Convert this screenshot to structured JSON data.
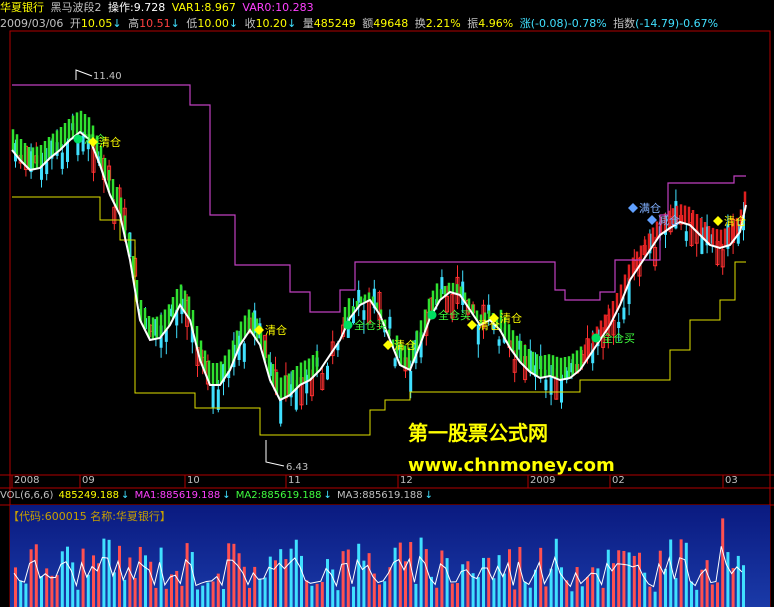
{
  "header": {
    "stock_name": "华夏银行",
    "indicator_name": "黑马波段2",
    "op_label": "操作:9.728",
    "var1": "VAR1:8.967",
    "var0": "VAR0:10.283"
  },
  "quote": {
    "date": "2009/03/06",
    "open_label": "开",
    "open": "10.05",
    "high_label": "高",
    "high": "10.51",
    "low_label": "低",
    "low": "10.00",
    "close_label": "收",
    "close": "10.20",
    "volume_label": "量",
    "volume": "485249",
    "amount_label": "额",
    "amount": "49648",
    "turnover_label": "换",
    "turnover": "2.21%",
    "amplitude_label": "振",
    "amplitude": "4.96%",
    "change_label": "涨",
    "change": "(-0.08)-0.78%",
    "index_label": "指数",
    "index_change": "(-14.79)-0.67%"
  },
  "price_labels": {
    "high_mark": "11.40",
    "low_mark": "6.43"
  },
  "signals": {
    "clear": "清仓",
    "full_buy": "全仓买",
    "add": "满仓",
    "reduce": "减仓"
  },
  "date_axis": [
    "2008",
    "09",
    "10",
    "11",
    "12",
    "2009",
    "02",
    "03"
  ],
  "volume_header": {
    "title": "VOL(6,6,6)",
    "vol": "485249.188",
    "ma1": "MA1:885619.188",
    "ma2": "MA2:885619.188",
    "ma3": "MA3:885619.188"
  },
  "info_bar": "【代码:600015 名称:华夏银行】",
  "watermark": {
    "line1": "第一股票公式网",
    "line2": "www.chnmoney.com"
  },
  "colors": {
    "up": "#ff3030",
    "down": "#40e0ff",
    "white_line": "#ffffff",
    "magenta": "#c040c0",
    "yellow": "#e0e000",
    "green": "#30e030",
    "red_band": "#e02020",
    "clear_diamond": "#ffff00",
    "buy_dot": "#00e060"
  }
}
